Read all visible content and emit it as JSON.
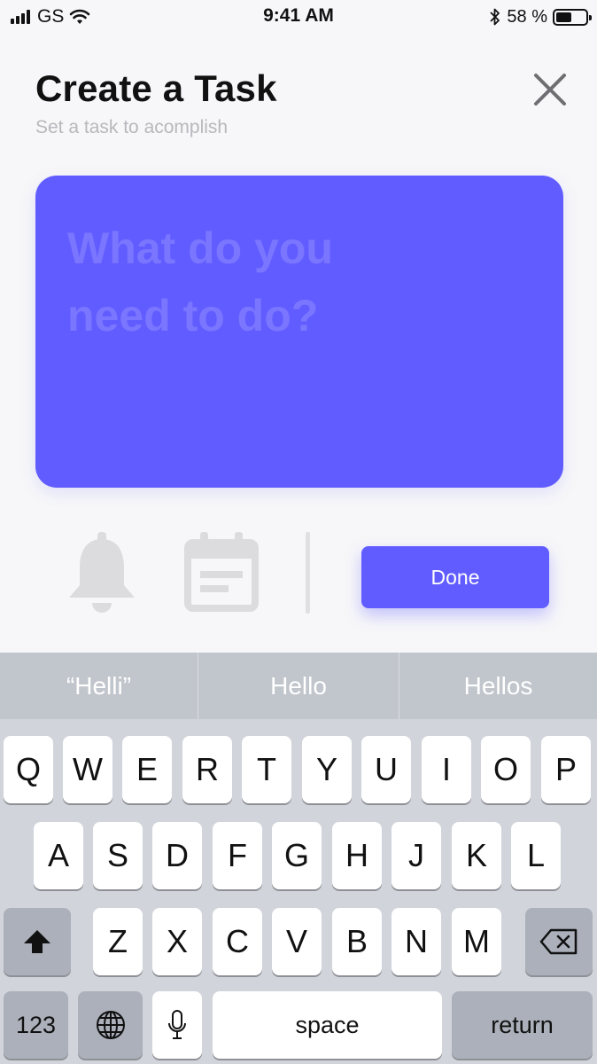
{
  "status_bar": {
    "carrier": "GS",
    "time": "9:41 AM",
    "battery": "58 %",
    "battery_level": 0.58
  },
  "header": {
    "title": "Create a Task",
    "subtitle": "Set a task to acomplish"
  },
  "task_input": {
    "placeholder": "What do you need to do?"
  },
  "actions": {
    "done_label": "Done"
  },
  "colors": {
    "accent": "#615cff",
    "placeholder": "#7a76ff",
    "icon_gray": "#dcdcde"
  },
  "keyboard": {
    "suggestions": [
      "“Helli”",
      "Hello",
      "Hellos"
    ],
    "row1": [
      "Q",
      "W",
      "E",
      "R",
      "T",
      "Y",
      "U",
      "I",
      "O",
      "P"
    ],
    "row2": [
      "A",
      "S",
      "D",
      "F",
      "G",
      "H",
      "J",
      "K",
      "L"
    ],
    "row3": [
      "Z",
      "X",
      "C",
      "V",
      "B",
      "N",
      "M"
    ],
    "numbers_label": "123",
    "space_label": "space",
    "return_label": "return"
  }
}
